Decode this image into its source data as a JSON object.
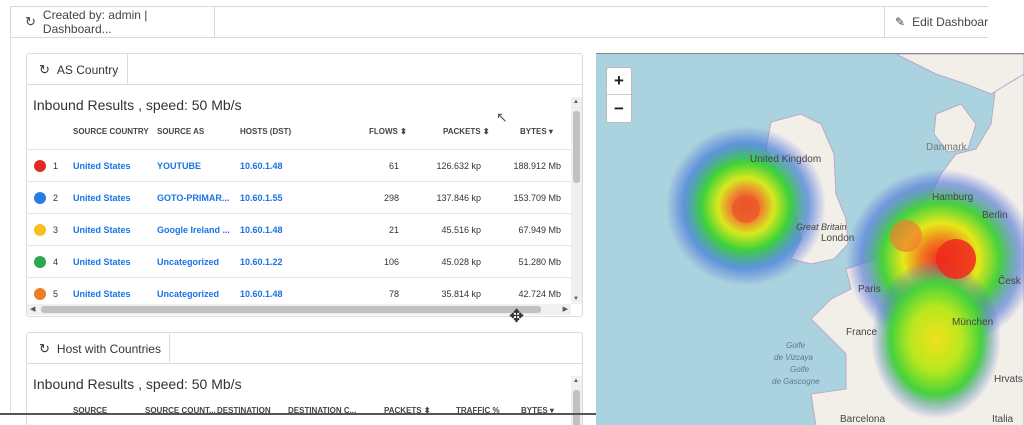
{
  "toolbar": {
    "title": "Created by: admin | Dashboard...",
    "edit_label": "Edit Dashboard"
  },
  "panel1": {
    "tab_label": "AS Country",
    "subtitle": "Inbound Results , speed: 50 Mb/s",
    "columns": {
      "source_country": "SOURCE COUNTRY",
      "source_as": "SOURCE AS",
      "hosts": "HOSTS (DST)",
      "flows": "FLOWS ⬍",
      "packets": "PACKETS ⬍",
      "bytes": "BYTES ▾"
    },
    "rows": [
      {
        "rank": "1",
        "color": "#e02b20",
        "country": "United States",
        "as": "YOUTUBE",
        "host": "10.60.1.48",
        "flows": "61",
        "packets": "126.632 kp",
        "bytes": "188.912 Mb"
      },
      {
        "rank": "2",
        "color": "#2b7be4",
        "country": "United States",
        "as": "GOTO-PRIMAR...",
        "host": "10.60.1.55",
        "flows": "298",
        "packets": "137.846 kp",
        "bytes": "153.709 Mb"
      },
      {
        "rank": "3",
        "color": "#f6be1e",
        "country": "United States",
        "as": "Google Ireland ...",
        "host": "10.60.1.48",
        "flows": "21",
        "packets": "45.516 kp",
        "bytes": "67.949 Mb"
      },
      {
        "rank": "4",
        "color": "#2fa84f",
        "country": "United States",
        "as": "Uncategorized",
        "host": "10.60.1.22",
        "flows": "106",
        "packets": "45.028 kp",
        "bytes": "51.280 Mb"
      },
      {
        "rank": "5",
        "color": "#f07c24",
        "country": "United States",
        "as": "Uncategorized",
        "host": "10.60.1.48",
        "flows": "78",
        "packets": "35.814 kp",
        "bytes": "42.724 Mb"
      }
    ]
  },
  "panel2": {
    "tab_label": "Host with Countries",
    "subtitle": "Inbound Results , speed: 50 Mb/s",
    "columns": {
      "source": "SOURCE",
      "source_country": "SOURCE COUNT...",
      "destination": "DESTINATION",
      "destination_country": "DESTINATION C...",
      "packets": "PACKETS ⬍",
      "traffic": "TRAFFIC %",
      "bytes": "BYTES ▾"
    }
  },
  "map": {
    "zoom_in": "+",
    "zoom_out": "−",
    "labels": {
      "united_kingdom": "United Kingdom",
      "denmark": "Danmark",
      "hamburg": "Hamburg",
      "berlin": "Berlin",
      "great_britain": "Great Britain",
      "london": "London",
      "paris": "Paris",
      "france": "France",
      "munchen": "München",
      "cesko": "Česk",
      "golfe1": "Golfe",
      "golfe2": "de Vizcaya",
      "golfe3": "Golfe",
      "golfe4": "de Gascogne",
      "hrvatska": "Hrvats",
      "barcelona": "Barcelona",
      "italia": "Italia"
    }
  },
  "icons": {
    "refresh": "refresh-icon",
    "edit": "pencil-icon"
  }
}
